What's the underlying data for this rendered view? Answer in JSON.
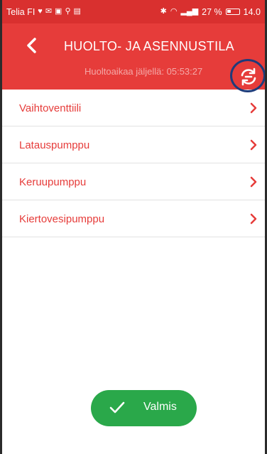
{
  "status_bar": {
    "carrier": "Telia FI",
    "battery": "27 %",
    "time": "14.0"
  },
  "header": {
    "title": "HUOLTO- JA ASENNUSTILA",
    "subtitle": "Huoltoaikaa jäljellä: 05:53:27"
  },
  "icons": {
    "back": "chevron-left-icon",
    "refresh": "refresh-icon",
    "row_chevron": "chevron-right-icon",
    "done": "check-icon"
  },
  "list": {
    "items": [
      {
        "label": "Vaihtoventtiili"
      },
      {
        "label": "Latauspumppu"
      },
      {
        "label": "Keruupumppu"
      },
      {
        "label": "Kiertovesipumppu"
      }
    ]
  },
  "actions": {
    "done_label": "Valmis"
  },
  "colors": {
    "header": "#e63c3a",
    "status_bar": "#d9302f",
    "accent_text": "#e63c3a",
    "done_button": "#2aa84a",
    "highlight_ring": "#1f3b7a"
  }
}
